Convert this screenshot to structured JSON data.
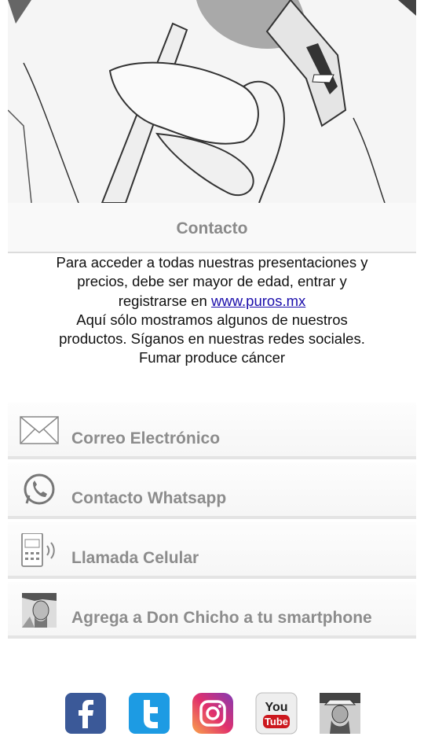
{
  "header": {
    "title": "Contacto"
  },
  "description": {
    "line_before_link": "Para acceder a todas nuestras presentaciones y precios, debe ser mayor de edad, entrar y registrarse en ",
    "link_text": "www.puros.mx",
    "after_link": "Aquí sólo mostramos algunos de nuestros productos. Síganos en nuestras redes sociales.",
    "warning": "Fumar produce cáncer"
  },
  "contacts": [
    {
      "label": "Correo Electrónico",
      "icon": "envelope-icon"
    },
    {
      "label": "Contacto Whatsapp",
      "icon": "whatsapp-icon"
    },
    {
      "label": "Llamada Celular",
      "icon": "phone-icon"
    },
    {
      "label": "Agrega a Don Chicho a tu smartphone",
      "icon": "portrait-icon"
    }
  ],
  "social": [
    {
      "icon": "facebook-icon",
      "color": "#3b5998"
    },
    {
      "icon": "twitter-icon",
      "color": "#1da1f2"
    },
    {
      "icon": "instagram-icon",
      "color": "#c13584"
    },
    {
      "icon": "youtube-icon",
      "color": "#cc181e"
    },
    {
      "icon": "don-chicho-photo-icon",
      "color": "#444444"
    }
  ]
}
